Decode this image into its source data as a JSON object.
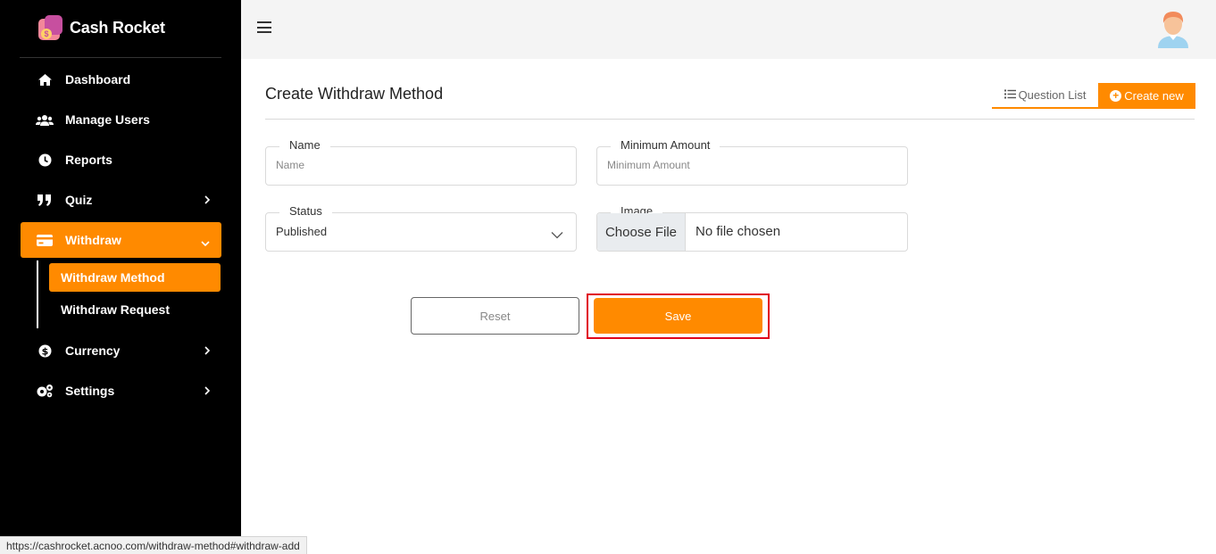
{
  "brand": {
    "name": "Cash Rocket"
  },
  "sidebar": {
    "items": [
      {
        "label": "Dashboard",
        "icon": "home-icon"
      },
      {
        "label": "Manage Users",
        "icon": "users-icon"
      },
      {
        "label": "Reports",
        "icon": "clock-icon"
      },
      {
        "label": "Quiz",
        "icon": "quote-icon"
      },
      {
        "label": "Withdraw",
        "icon": "credit-card-icon",
        "expanded": true,
        "active": true
      },
      {
        "label": "Currency",
        "icon": "dollar-circle-icon"
      },
      {
        "label": "Settings",
        "icon": "gears-icon"
      }
    ],
    "withdraw_submenu": [
      {
        "label": "Withdraw Method",
        "active": true
      },
      {
        "label": "Withdraw Request"
      }
    ]
  },
  "header": {
    "menu_icon": "hamburger-icon",
    "avatar_icon": "user-avatar-icon"
  },
  "main": {
    "title": "Create Withdraw Method",
    "question_list_label": "Question List",
    "create_new_label": "Create new",
    "form": {
      "name": {
        "label": "Name",
        "placeholder": "Name",
        "value": ""
      },
      "minimum_amount": {
        "label": "Minimum Amount",
        "placeholder": "Minimum Amount",
        "value": ""
      },
      "status": {
        "label": "Status",
        "value": "Published"
      },
      "image": {
        "label": "Image",
        "button_label": "Choose File",
        "file_text": "No file chosen"
      },
      "reset_label": "Reset",
      "save_label": "Save"
    }
  },
  "statusbar": {
    "url": "https://cashrocket.acnoo.com/withdraw-method#withdraw-add"
  },
  "colors": {
    "accent": "#ff8a00",
    "sidebar_bg": "#000000",
    "highlight_frame": "#e0001b"
  }
}
